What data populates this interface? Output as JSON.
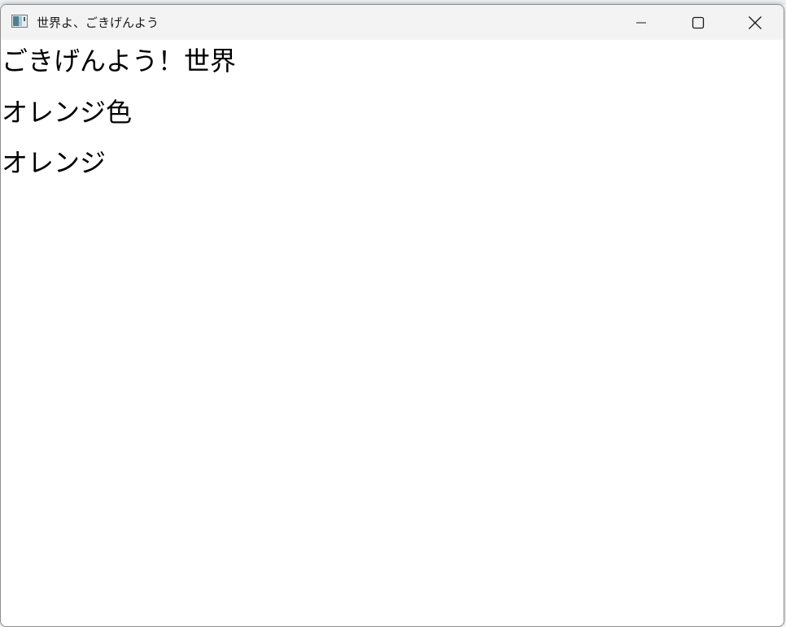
{
  "window": {
    "title": "世界よ、ごきげんよう",
    "controls": {
      "minimize_icon": "minimize-icon",
      "maximize_icon": "maximize-icon",
      "close_icon": "close-icon"
    }
  },
  "content": {
    "labels": [
      "ごきげんよう！世界",
      "オレンジ色",
      "オレンジ"
    ]
  },
  "colors": {
    "titlebar_bg": "#f3f3f3",
    "content_bg": "#ffffff",
    "text": "#000000"
  }
}
